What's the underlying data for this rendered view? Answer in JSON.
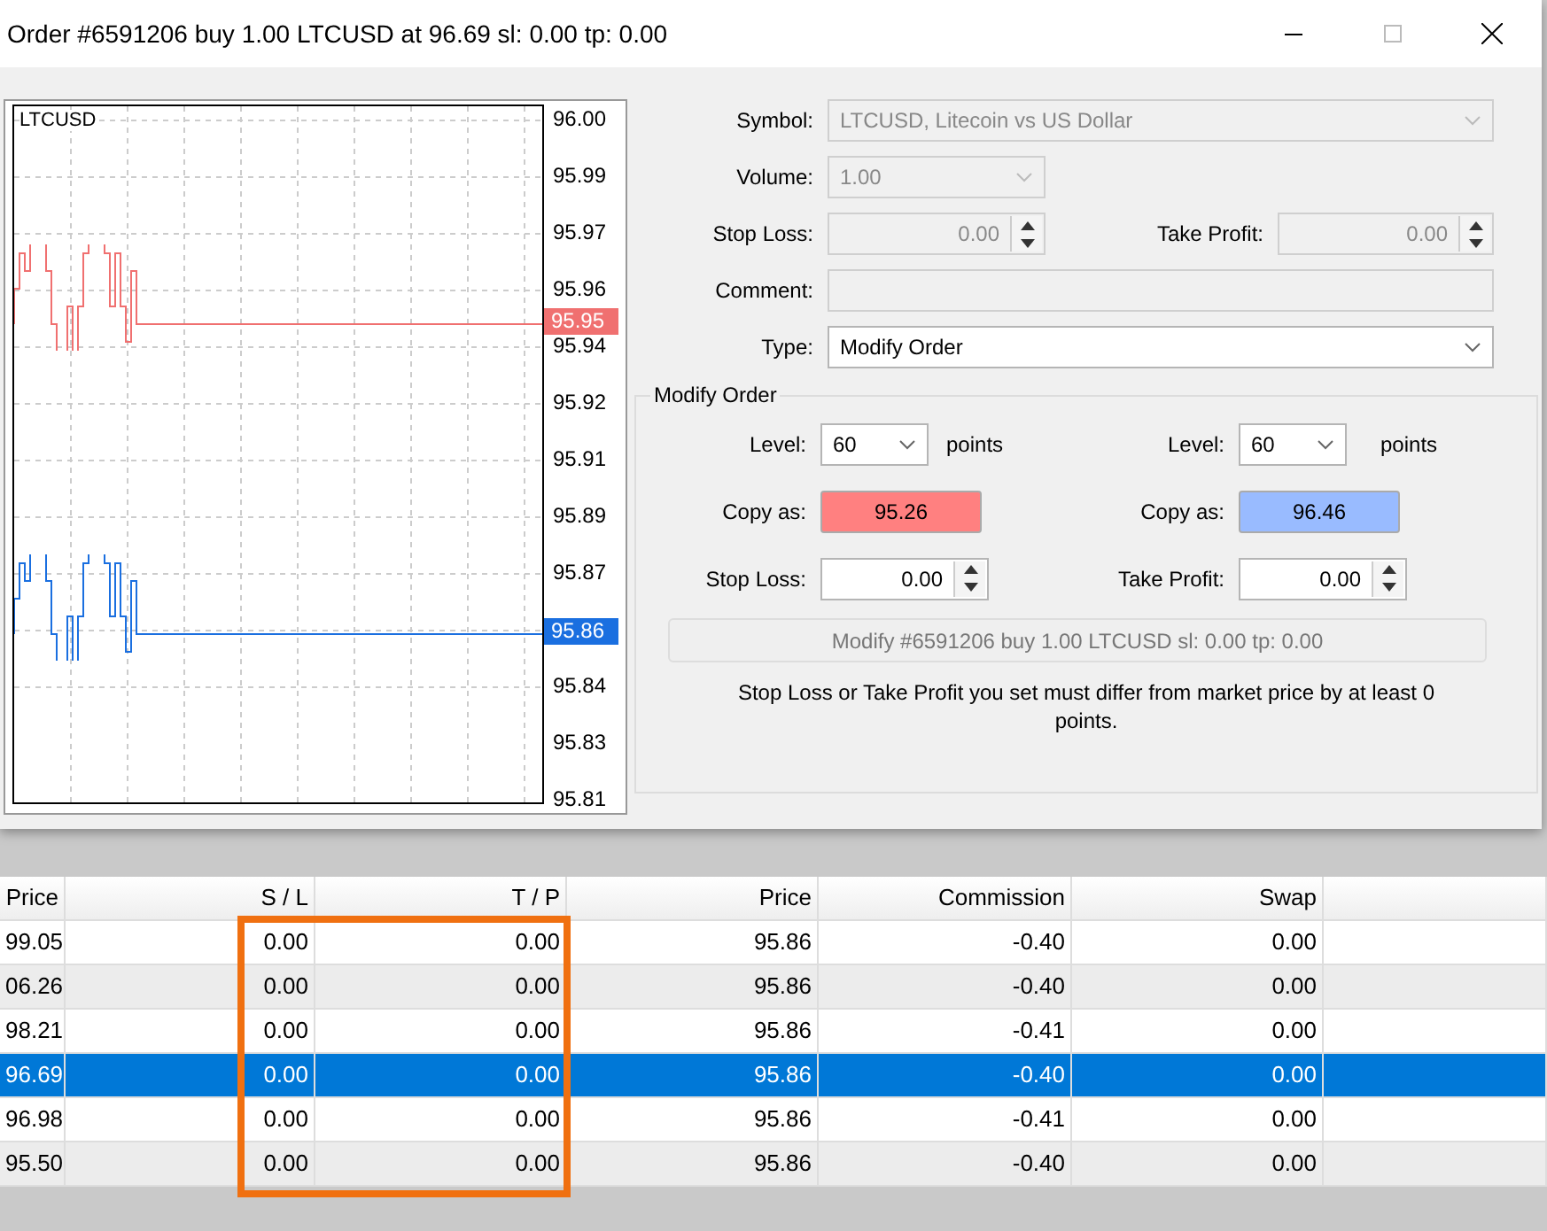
{
  "window": {
    "title": "Order #6591206 buy 1.00 LTCUSD at 96.69 sl: 0.00 tp: 0.00"
  },
  "chart": {
    "symbol": "LTCUSD",
    "axis_labels": [
      "96.00",
      "95.99",
      "95.97",
      "95.96",
      "95.94",
      "95.92",
      "95.91",
      "95.89",
      "95.87",
      "95.84",
      "95.83",
      "95.81"
    ],
    "tags": [
      {
        "label": "95.95",
        "color": "#f07070"
      },
      {
        "label": "95.86",
        "color": "#1a6fe0"
      }
    ]
  },
  "form": {
    "symbol_label": "Symbol:",
    "symbol_value": "LTCUSD, Litecoin vs US Dollar",
    "volume_label": "Volume:",
    "volume_value": "1.00",
    "stop_loss_label": "Stop Loss:",
    "stop_loss_value": "0.00",
    "take_profit_label": "Take Profit:",
    "take_profit_value": "0.00",
    "comment_label": "Comment:",
    "type_label": "Type:",
    "type_value": "Modify Order",
    "disabled": true
  },
  "modify": {
    "title": "Modify Order",
    "sides": [
      {
        "level_label": "Level:",
        "level_value": "60",
        "points": "points",
        "copy_label": "Copy as:",
        "copy_value": "95.26",
        "color": "#ff8080",
        "sl_label": "Stop Loss:",
        "sl_value": "0.00"
      },
      {
        "level_label": "Level:",
        "level_value": "60",
        "points": "points",
        "copy_label": "Copy as:",
        "copy_value": "96.46",
        "color": "#99bbff",
        "sl_label": "Take Profit:",
        "sl_value": "0.00"
      }
    ],
    "button": {
      "label": "Modify #6591206 buy 1.00 LTCUSD sl: 0.00 tp: 0.00",
      "disabled": true
    },
    "message": "Stop Loss or Take Profit you set must differ from market price by at least 0 points."
  },
  "table": {
    "columns": [
      "Price",
      "S / L",
      "T / P",
      "Price",
      "Commission",
      "Swap"
    ],
    "highlight_frame": true,
    "rows": [
      {
        "cells": [
          "99.05",
          "0.00",
          "0.00",
          "95.86",
          "-0.40",
          "0.00"
        ],
        "selected": false
      },
      {
        "cells": [
          "06.26",
          "0.00",
          "0.00",
          "95.86",
          "-0.40",
          "0.00"
        ],
        "selected": false
      },
      {
        "cells": [
          "98.21",
          "0.00",
          "0.00",
          "95.86",
          "-0.41",
          "0.00"
        ],
        "selected": false
      },
      {
        "cells": [
          "96.69",
          "0.00",
          "0.00",
          "95.86",
          "-0.40",
          "0.00"
        ],
        "selected": true
      },
      {
        "cells": [
          "96.98",
          "0.00",
          "0.00",
          "95.86",
          "-0.41",
          "0.00"
        ],
        "selected": false
      },
      {
        "cells": [
          "95.50",
          "0.00",
          "0.00",
          "95.86",
          "-0.40",
          "0.00"
        ],
        "selected": false
      }
    ]
  }
}
